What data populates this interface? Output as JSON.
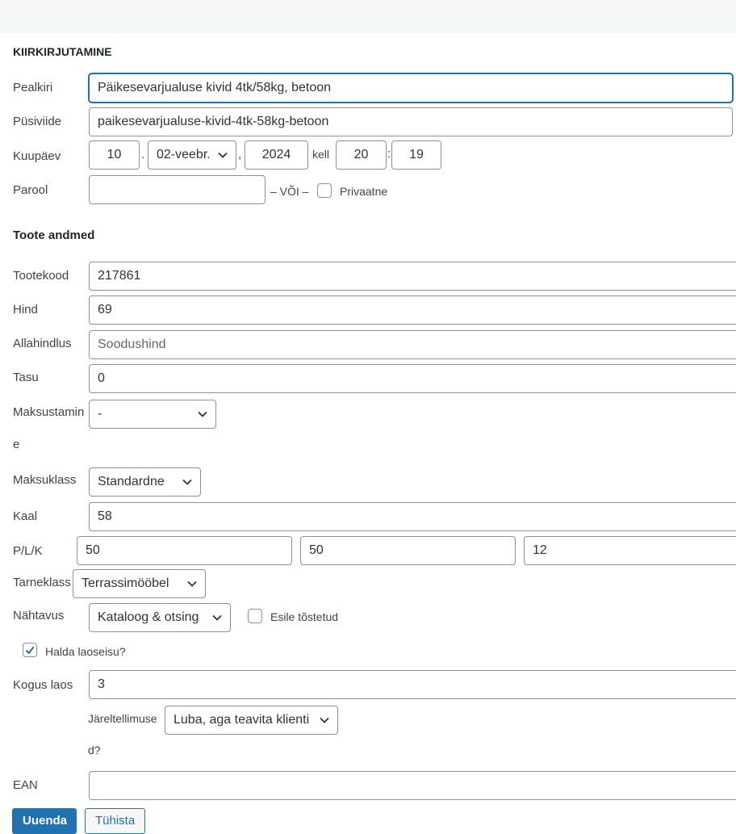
{
  "quick_edit": {
    "title": "KIIRKIRJUTAMINE",
    "title_label": "Pealkiri",
    "title_value": "Päikesevarjualuse kivid 4tk/58kg, betoon",
    "slug_label": "Püsiviide",
    "slug_value": "paikesevarjualuse-kivid-4tk-58kg-betoon",
    "date_label": "Kuupäev",
    "date_day": "10",
    "date_dot": ".",
    "date_month": "02-veebr.",
    "date_comma": ",",
    "date_year": "2024",
    "date_at": "kell",
    "date_hour": "20",
    "date_colon": ":",
    "date_minute": "19",
    "password_label": "Parool",
    "password_value": "",
    "or_text": "– VÕI –",
    "private_label": "Privaatne"
  },
  "product_data": {
    "title": "Toote andmed",
    "sku_label": "Tootekood",
    "sku_value": "217861",
    "price_label": "Hind",
    "price_value": "69",
    "sale_label": "Allahindlus",
    "sale_placeholder": "Soodushind",
    "fee_label": "Tasu",
    "fee_value": "0",
    "tax_status_label_1": "Maksustamin",
    "tax_status_label_2": "e",
    "tax_status_value": "-",
    "tax_class_label": "Maksuklass",
    "tax_class_value": "Standardne",
    "weight_label": "Kaal",
    "weight_value": "58",
    "dims_label": "P/L/K",
    "length_value": "50",
    "width_value": "50",
    "height_value": "12",
    "shipping_label": "Tarneklass",
    "shipping_value": "Terrassimööbel",
    "visibility_label": "Nähtavus",
    "visibility_value": "Kataloog & otsing",
    "featured_label": "Esile tõstetud",
    "manage_stock_label": "Halda laoseisu?",
    "manage_stock_checked": true,
    "stock_qty_label": "Kogus laos",
    "stock_qty_value": "3",
    "backorders_label_1": "Järeltellimuse",
    "backorders_label_2": "d?",
    "backorders_value": "Luba, aga teavita klienti",
    "ean_label": "EAN",
    "ean_value": ""
  },
  "actions": {
    "update": "Uuenda",
    "cancel": "Tühista"
  },
  "colors": {
    "accent": "#2271b1",
    "border": "#8c8f94",
    "topbar": "#f6f7f7"
  }
}
